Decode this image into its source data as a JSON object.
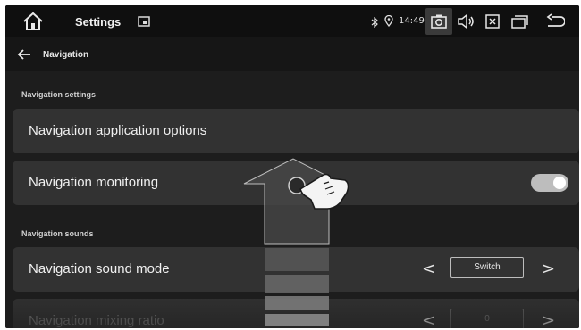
{
  "statusbar": {
    "title": "Settings",
    "time": "14:49",
    "icons": [
      "home-icon",
      "screen-icon",
      "bluetooth-icon",
      "location-icon",
      "camera-icon",
      "volume-icon",
      "close-box-icon",
      "window-icon",
      "return-icon"
    ]
  },
  "nav": {
    "title": "Navigation",
    "back_icon": "back-arrow-icon"
  },
  "sections": {
    "settings_label": "Navigation settings",
    "sounds_label": "Navigation sounds"
  },
  "rows": {
    "app_options": "Navigation application options",
    "monitoring": "Navigation monitoring",
    "monitoring_toggle_on": true,
    "sound_mode": "Navigation sound mode",
    "sound_mode_value": "Switch",
    "mixing_ratio": "Navigation mixing ratio",
    "mixing_ratio_value": "0",
    "prev_glyph": "<",
    "next_glyph": ">"
  },
  "overlay": {
    "icons": [
      "up-arrow-icon",
      "hand-pointer-icon"
    ]
  },
  "colors": {
    "background": "#1d1d1d",
    "row": "#323232",
    "statusbar": "#0f0f0f",
    "toggle": "#bdbdbd"
  }
}
